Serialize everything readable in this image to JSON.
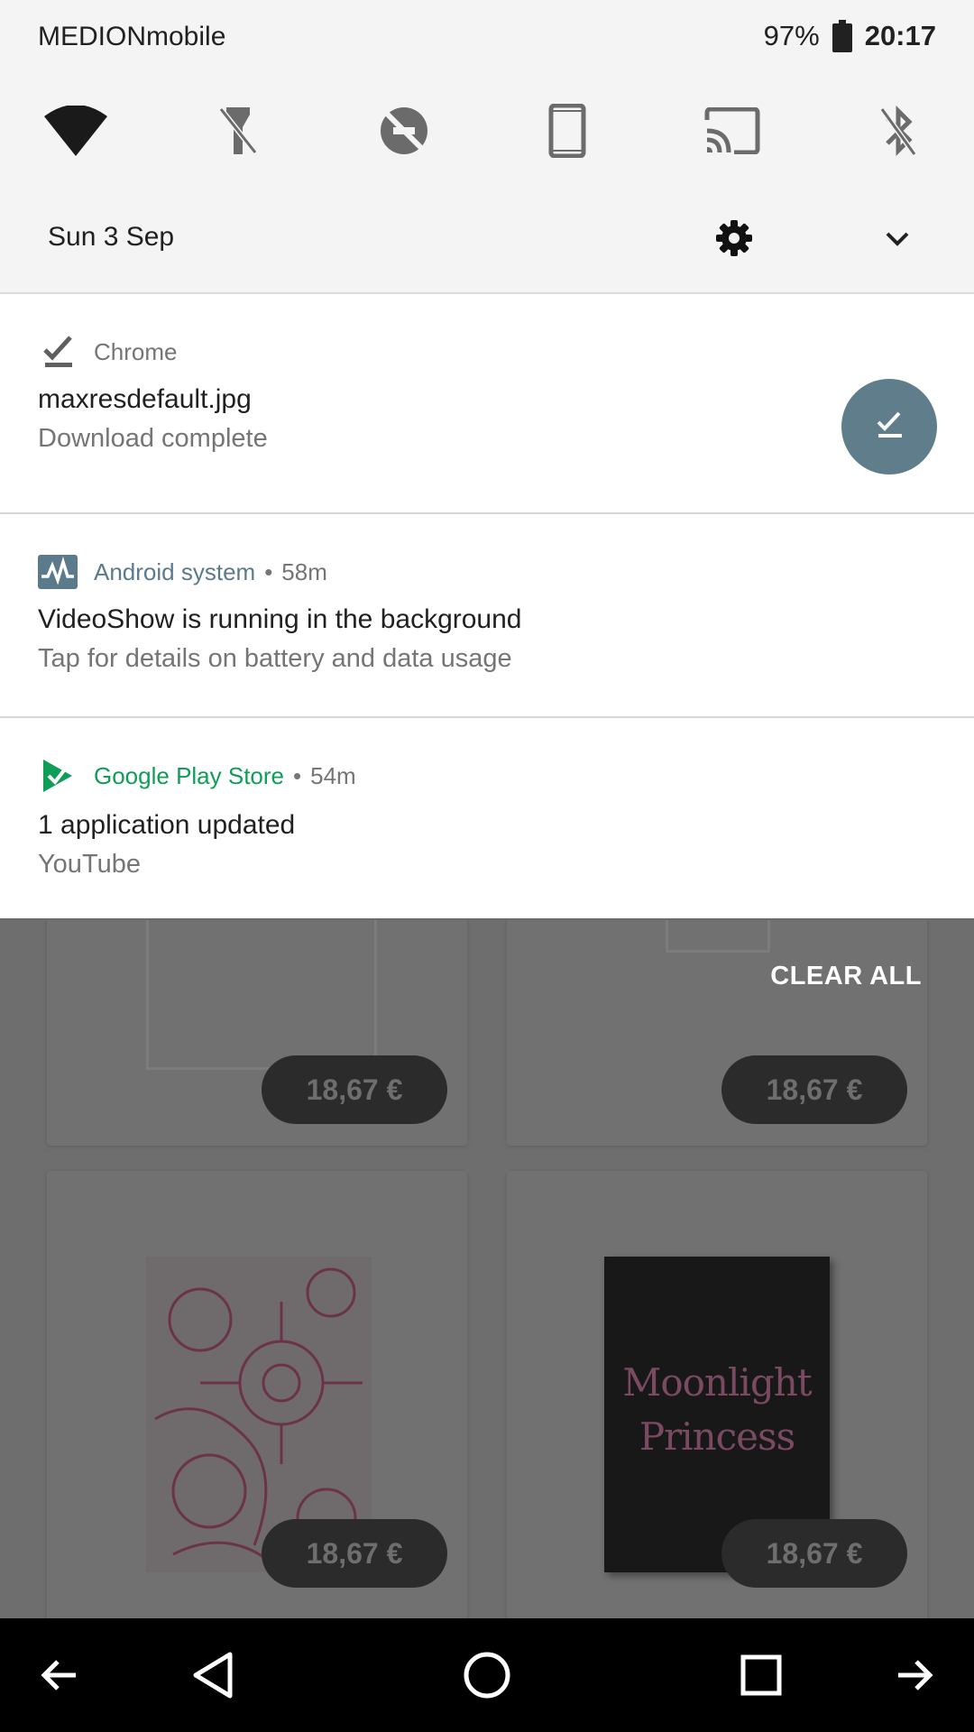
{
  "status_bar": {
    "carrier": "MEDIONmobile",
    "battery_percent": "97%",
    "time": "20:17"
  },
  "quick_settings": {
    "tiles": [
      "wifi-icon",
      "flashlight-off-icon",
      "data-saver-off-icon",
      "auto-rotate-portrait-icon",
      "cast-icon",
      "bluetooth-off-icon"
    ],
    "date": "Sun 3 Sep"
  },
  "notifications": [
    {
      "app": "Chrome",
      "time": "",
      "title": "maxresdefault.jpg",
      "text": "Download complete",
      "icon": "download-done-icon"
    },
    {
      "app": "Android system",
      "time": "58m",
      "title": "VideoShow is running in the background",
      "text": "Tap for details on battery and data usage",
      "icon": "activity-monitor-icon",
      "app_color": "#5b7a8c"
    },
    {
      "app": "Google Play Store",
      "time": "54m",
      "title": "1 application updated",
      "text": "YouTube",
      "icon": "play-store-check-icon",
      "app_color": "#0f9d58"
    }
  ],
  "clear_all_label": "CLEAR ALL",
  "background_app": {
    "prices": [
      "18,67 €",
      "18,67 €",
      "18,67 €",
      "18,67 €"
    ],
    "book_cover_line1": "Moonlight",
    "book_cover_line2": "Princess"
  },
  "colors": {
    "fab": "#607d8b",
    "android_system": "#5b7a8c",
    "play_store": "#0f9d58"
  }
}
